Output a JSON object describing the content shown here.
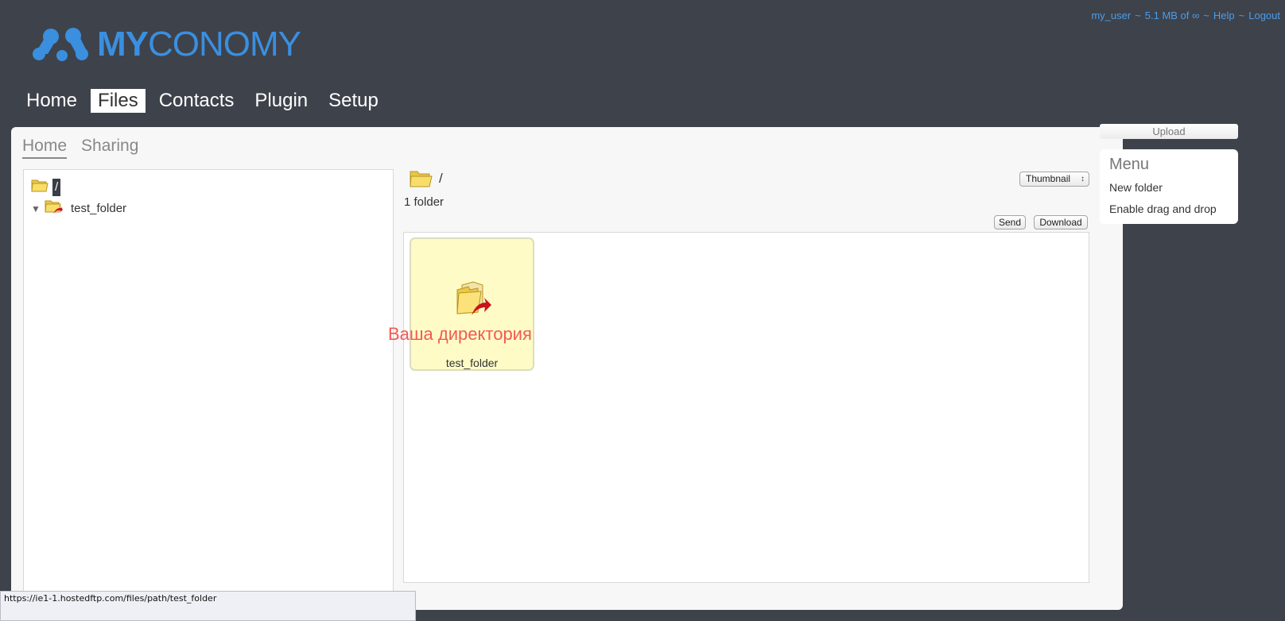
{
  "colors": {
    "background": "#3e424b",
    "brand": "#3a8fdf",
    "link": "#4a9eea",
    "caption": "#f25a54",
    "tile": "#fefbc7"
  },
  "account": {
    "username": "my_user",
    "sep1": "~",
    "usage": "5.1 MB of ∞",
    "sep2": "~",
    "help": "Help",
    "sep3": "~",
    "logout": "Logout"
  },
  "logo": {
    "my": "MY",
    "conomy": "CONOMY"
  },
  "nav": [
    {
      "label": "Home",
      "active": false
    },
    {
      "label": "Files",
      "active": true
    },
    {
      "label": "Contacts",
      "active": false
    },
    {
      "label": "Plugin",
      "active": false
    },
    {
      "label": "Setup",
      "active": false
    }
  ],
  "subtabs": [
    {
      "label": "Home",
      "active": true
    },
    {
      "label": "Sharing",
      "active": false
    }
  ],
  "tree": {
    "root_label": "/",
    "items": [
      {
        "label": "test_folder",
        "expanded": true,
        "icon": "shared-folder-icon"
      }
    ]
  },
  "browser": {
    "path": "/",
    "view_mode": "Thumbnail",
    "folder_count": "1 folder",
    "send_label": "Send",
    "download_label": "Download",
    "files": [
      {
        "name": "test_folder",
        "icon": "shared-folder-icon"
      }
    ]
  },
  "caption": "Ваша директория",
  "sidebar": {
    "upload_label": "Upload",
    "menu_title": "Menu",
    "menu_items": [
      {
        "label": "New folder"
      },
      {
        "label": "Enable drag and drop"
      }
    ]
  },
  "status_url": "https://ie1-1.hostedftp.com/files/path/test_folder"
}
